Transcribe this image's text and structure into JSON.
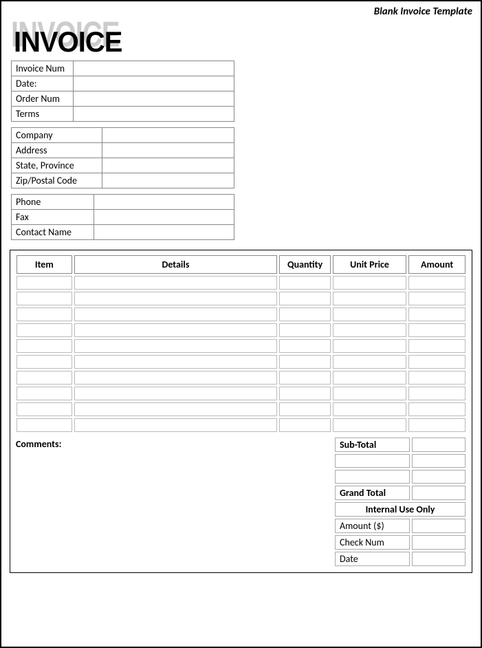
{
  "header": {
    "top_label": "Blank Invoice Template",
    "logo_text": "INVOICE"
  },
  "meta": {
    "invoice_num_label": "Invoice Num",
    "invoice_num": "",
    "date_label": "Date:",
    "date": "",
    "order_num_label": "Order Num",
    "order_num": "",
    "terms_label": "Terms",
    "terms": ""
  },
  "company": {
    "company_label": "Company",
    "company": "",
    "address_label": "Address",
    "address": "",
    "state_label": "State, Province",
    "state": "",
    "zip_label": "Zip/Postal Code",
    "zip": ""
  },
  "contact": {
    "phone_label": "Phone",
    "phone": "",
    "fax_label": "Fax",
    "fax": "",
    "name_label": "Contact Name",
    "name": ""
  },
  "items": {
    "headers": {
      "item": "Item",
      "details": "Details",
      "quantity": "Quantity",
      "unit_price": "Unit Price",
      "amount": "Amount"
    },
    "rows": [
      {
        "item": "",
        "details": "",
        "quantity": "",
        "unit_price": "",
        "amount": ""
      },
      {
        "item": "",
        "details": "",
        "quantity": "",
        "unit_price": "",
        "amount": ""
      },
      {
        "item": "",
        "details": "",
        "quantity": "",
        "unit_price": "",
        "amount": ""
      },
      {
        "item": "",
        "details": "",
        "quantity": "",
        "unit_price": "",
        "amount": ""
      },
      {
        "item": "",
        "details": "",
        "quantity": "",
        "unit_price": "",
        "amount": ""
      },
      {
        "item": "",
        "details": "",
        "quantity": "",
        "unit_price": "",
        "amount": ""
      },
      {
        "item": "",
        "details": "",
        "quantity": "",
        "unit_price": "",
        "amount": ""
      },
      {
        "item": "",
        "details": "",
        "quantity": "",
        "unit_price": "",
        "amount": ""
      },
      {
        "item": "",
        "details": "",
        "quantity": "",
        "unit_price": "",
        "amount": ""
      },
      {
        "item": "",
        "details": "",
        "quantity": "",
        "unit_price": "",
        "amount": ""
      }
    ]
  },
  "comments_label": "Comments:",
  "totals": {
    "subtotal_label": "Sub-Total",
    "subtotal": "",
    "extra1_label": "",
    "extra1": "",
    "extra2_label": "",
    "extra2": "",
    "grand_label": "Grand Total",
    "grand": "",
    "internal_header": "Internal Use Only",
    "int_amount_label": "Amount ($)",
    "int_amount": "",
    "int_check_label": "Check Num",
    "int_check": "",
    "int_date_label": "Date",
    "int_date": ""
  }
}
